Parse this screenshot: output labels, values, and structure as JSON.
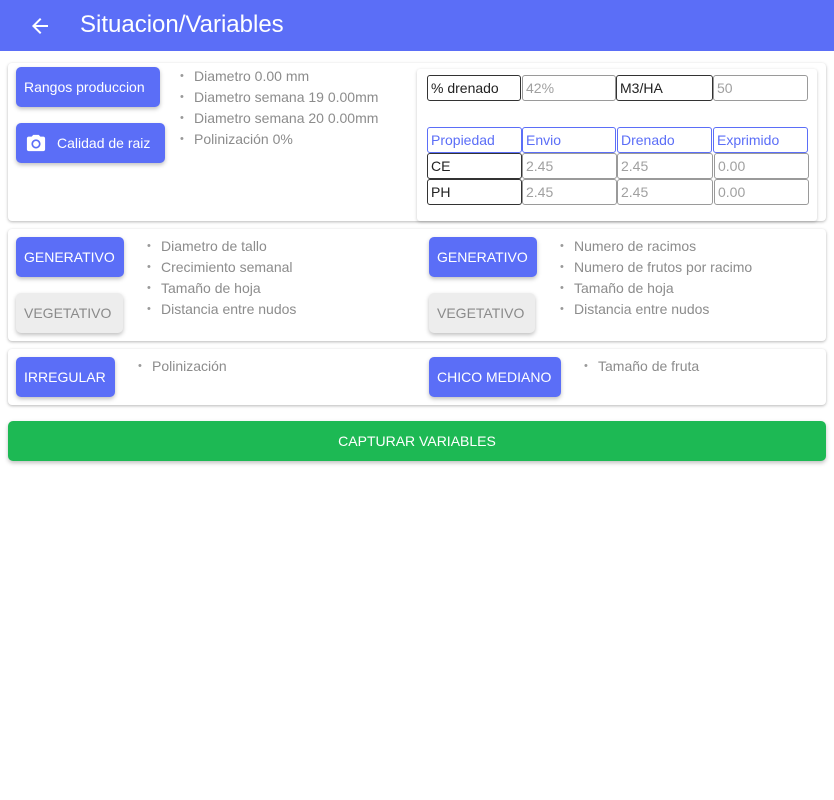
{
  "header": {
    "title": "Situacion/Variables",
    "back_icon": "arrow-left-icon"
  },
  "colors": {
    "primary": "#5b6ef7",
    "success": "#1db954",
    "secondary": "#ededed"
  },
  "section1": {
    "rangos_button": "Rangos produccion",
    "calidad_button": "Calidad de raiz",
    "camera_icon": "camera-icon",
    "bullets": [
      "Diametro 0.00 mm",
      "Diametro semana 19 0.00mm",
      "Diametro semana 20 0.00mm",
      "Polinización 0%"
    ],
    "drenado": {
      "label": "% drenado",
      "value": "42%",
      "m3_label": "M3/HA",
      "m3_value": "50"
    },
    "table": {
      "headers": [
        "Propiedad",
        "Envio",
        "Drenado",
        "Exprimido"
      ],
      "rows": [
        {
          "prop": "CE",
          "envio": "2.45",
          "drenado": "2.45",
          "exprimido": "0.00"
        },
        {
          "prop": "PH",
          "envio": "2.45",
          "drenado": "2.45",
          "exprimido": "0.00"
        }
      ]
    }
  },
  "section2": {
    "left": {
      "generativo": "GENERATIVO",
      "vegetativo": "VEGETATIVO",
      "bullets": [
        "Diametro de tallo",
        "Crecimiento semanal",
        "Tamaño de hoja",
        "Distancia entre nudos"
      ]
    },
    "right": {
      "generativo": "GENERATIVO",
      "vegetativo": "VEGETATIVO",
      "bullets": [
        "Numero de racimos",
        "Numero de frutos por racimo",
        "Tamaño de hoja",
        "Distancia entre nudos"
      ]
    }
  },
  "section3": {
    "left": {
      "button": "IRREGULAR",
      "bullets": [
        "Polinización"
      ]
    },
    "right": {
      "button": "CHICO MEDIANO",
      "bullets": [
        "Tamaño de fruta"
      ]
    }
  },
  "capture_button": "CAPTURAR VARIABLES"
}
